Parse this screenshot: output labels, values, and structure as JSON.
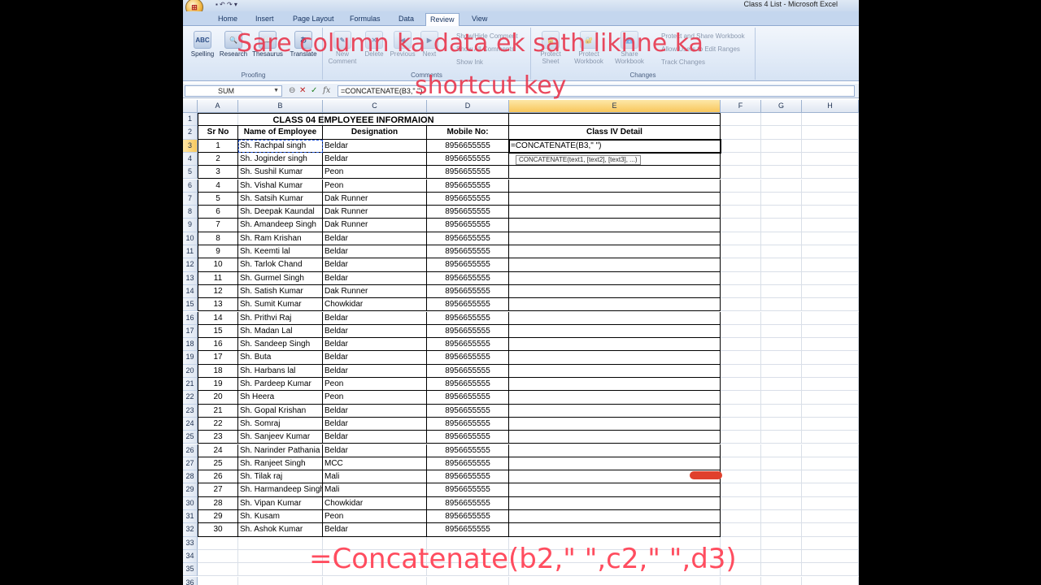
{
  "window": {
    "title": "Class 4 List - Microsoft Excel",
    "office_button": "⊞"
  },
  "ribbon": {
    "tabs": [
      "Home",
      "Insert",
      "Page Layout",
      "Formulas",
      "Data",
      "Review",
      "View"
    ],
    "active_tab": "Review",
    "groups": [
      {
        "label": "Proofing",
        "buttons": [
          "Spelling",
          "Research",
          "Thesaurus",
          "Translate"
        ]
      },
      {
        "label": "Comments",
        "buttons": [
          "New Comment",
          "Delete",
          "Previous",
          "Next"
        ],
        "small": [
          "Show/Hide Comment",
          "Show All Comments",
          "Show Ink"
        ]
      },
      {
        "label": "Changes",
        "buttons": [
          "Protect Sheet",
          "Protect Workbook",
          "Share Workbook"
        ],
        "small": [
          "Protect and Share Workbook",
          "Allow Users to Edit Ranges",
          "Track Changes"
        ]
      }
    ]
  },
  "formula_bar": {
    "name_box": "SUM",
    "formula": "=CONCATENATE(B3,\" \")"
  },
  "sheet": {
    "columns": [
      "A",
      "B",
      "C",
      "D",
      "E",
      "F",
      "G",
      "H"
    ],
    "title": "CLASS 04  EMPLOYEEE INFORMAION",
    "headers": [
      "Sr No",
      "Name of Employee",
      "Designation",
      "Mobile No:",
      "Class IV Detail"
    ],
    "rows": [
      [
        "1",
        "Sh. Rachpal singh",
        "Beldar",
        "8956655555"
      ],
      [
        "2",
        "Sh. Joginder singh",
        "Beldar",
        "8956655555"
      ],
      [
        "3",
        "Sh. Sushil Kumar",
        "Peon",
        "8956655555"
      ],
      [
        "4",
        "Sh. Vishal Kumar",
        "Peon",
        "8956655555"
      ],
      [
        "5",
        "Sh. Satsih Kumar",
        "Dak Runner",
        "8956655555"
      ],
      [
        "6",
        "Sh. Deepak Kaundal",
        "Dak Runner",
        "8956655555"
      ],
      [
        "7",
        "Sh. Amandeep Singh",
        "Dak Runner",
        "8956655555"
      ],
      [
        "8",
        "Sh. Ram Krishan",
        "Beldar",
        "8956655555"
      ],
      [
        "9",
        "Sh. Keemti lal",
        "Beldar",
        "8956655555"
      ],
      [
        "10",
        "Sh. Tarlok Chand",
        "Beldar",
        "8956655555"
      ],
      [
        "11",
        "Sh. Gurmel Singh",
        "Beldar",
        "8956655555"
      ],
      [
        "12",
        "Sh. Satish Kumar",
        "Dak Runner",
        "8956655555"
      ],
      [
        "13",
        "Sh. Sumit Kumar",
        "Chowkidar",
        "8956655555"
      ],
      [
        "14",
        "Sh. Prithvi Raj",
        "Beldar",
        "8956655555"
      ],
      [
        "15",
        "Sh. Madan Lal",
        "Beldar",
        "8956655555"
      ],
      [
        "16",
        "Sh. Sandeep Singh",
        "Beldar",
        "8956655555"
      ],
      [
        "17",
        "Sh. Buta",
        "Beldar",
        "8956655555"
      ],
      [
        "18",
        "Sh. Harbans lal",
        "Beldar",
        "8956655555"
      ],
      [
        "19",
        "Sh. Pardeep Kumar",
        "Peon",
        "8956655555"
      ],
      [
        "20",
        "Sh Heera",
        "Peon",
        "8956655555"
      ],
      [
        "21",
        "Sh. Gopal Krishan",
        "Beldar",
        "8956655555"
      ],
      [
        "22",
        "Sh. Somraj",
        "Beldar",
        "8956655555"
      ],
      [
        "23",
        "Sh. Sanjeev Kumar",
        "Beldar",
        "8956655555"
      ],
      [
        "24",
        "Sh. Narinder Pathania",
        "Beldar",
        "8956655555"
      ],
      [
        "25",
        "Sh. Ranjeet Singh",
        "MCC",
        "8956655555"
      ],
      [
        "26",
        "Sh. Tilak raj",
        "Mali",
        "8956655555"
      ],
      [
        "27",
        "Sh. Harmandeep Singh",
        "Mali",
        "8956655555"
      ],
      [
        "28",
        "Sh. Vipan Kumar",
        "Chowkidar",
        "8956655555"
      ],
      [
        "29",
        "Sh. Kusam",
        "Peon",
        "8956655555"
      ],
      [
        "30",
        "Sh. Ashok Kumar",
        "Beldar",
        "8956655555"
      ]
    ],
    "editing_cell": "=CONCATENATE(B3,\" \")",
    "tooltip": "CONCATENATE(text1, [text2], [text3], ...)"
  },
  "overlay": {
    "title_line1": "Sare column ka data ek sath likhne ka",
    "title_line2": "shortcut key",
    "formula": "=Concatenate(b2,\" \",c2,\" \",d3)"
  },
  "colors": {
    "overlay_text": "#e8364d",
    "selected_header": "#f8c75b"
  }
}
